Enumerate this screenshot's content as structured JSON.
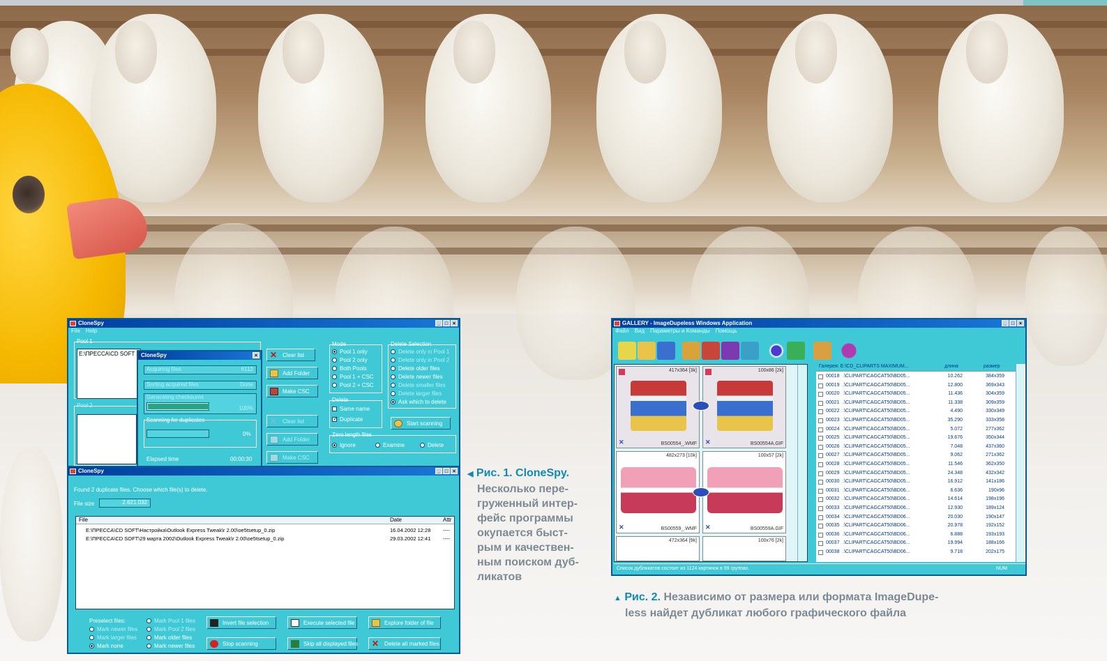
{
  "clonespy": {
    "title": "CloneSpy",
    "menu": [
      "File",
      "Help"
    ],
    "pool1_label": "Pool 1",
    "pool1_item": "E:\\ПРЕССА\\CD SOFT",
    "pool2_label": "Pool 2",
    "buttons": {
      "clear_list": "Clear list",
      "add_folder": "Add Folder",
      "make_csc": "Make CSC",
      "clear_list2": "Clear list",
      "add_folder2": "Add Folder",
      "make_csc2": "Make CSC",
      "start_scanning": "Start scanning"
    },
    "mode": {
      "label": "Mode",
      "options": [
        "Pool 1 only",
        "Pool 2 only",
        "Both Pools",
        "Pool 1 + CSC",
        "Pool 2 + CSC"
      ],
      "selected": "Pool 1 only"
    },
    "delete": {
      "label": "Delete",
      "same_name": "Same name",
      "duplicate": "Duplicate"
    },
    "zero_length": {
      "label": "Zero length files",
      "options": [
        "Ignore",
        "Examine",
        "Delete"
      ],
      "selected": "Ignore"
    },
    "delete_selection": {
      "label": "Delete Selection",
      "options": [
        "Delete only in Pool 1",
        "Delete only in Pool 2",
        "Delete older files",
        "Delete newer files",
        "Delete smaller files",
        "Delete larger files",
        "Ask which to delete"
      ],
      "selected": "Ask which to delete"
    },
    "progress_dialog": {
      "title": "CloneSpy",
      "rows": [
        {
          "label": "Acquiring files",
          "value": "6112"
        },
        {
          "label": "Sorting acquired files",
          "value": "Done"
        },
        {
          "label": "Generating checksums",
          "value": "100%"
        }
      ],
      "checksum_progress": 1.0,
      "scanning_label": "Scanning for duplicates",
      "scanning_value": "0%",
      "scanning_progress": 0.0,
      "elapsed_label": "Elapsed time",
      "elapsed_value": "00:00:30"
    }
  },
  "clonespy2": {
    "title": "CloneSpy",
    "message": "Found 2 duplicate files. Choose which file(s) to delete.",
    "file_size_label": "File size",
    "file_size_value": "2.621.032",
    "columns": [
      "File",
      "Date",
      "Attr"
    ],
    "files": [
      {
        "path": "E:\\ПРЕССА\\CD SOFT\\Настройка\\Outlook Express Tweak\\r 2.00\\oe5tsetup_0.zip",
        "date": "16.04.2002 12:28",
        "attr": "----"
      },
      {
        "path": "E:\\ПРЕССА\\CD SOFT\\29 марта 2002\\Outlook Express Tweak\\r 2.00\\oe5tsetup_0.zip",
        "date": "29.03.2002 12:41",
        "attr": "----"
      }
    ],
    "preselect_label": "Preselect files:",
    "preselect": [
      "Mark newer files",
      "Mark larger files",
      "Mark none",
      "Mark Pool 1 files",
      "Mark Pool 2 files",
      "Mark older files",
      "Mark newer files"
    ],
    "actions": {
      "invert": "Invert file selection",
      "execute": "Execute selected file",
      "explore": "Explore folder of file",
      "stop": "Stop scanning",
      "skip": "Skip all displayed files",
      "delete_marked": "Delete all marked files"
    }
  },
  "caption1": {
    "head": "Рис. 1. CloneSpy.",
    "lines": [
      "Несколько пере-",
      "груженный интер-",
      "фейс программы",
      "окупается быст-",
      "рым и качествен-",
      "ным поиском дуб-",
      "ликатов"
    ]
  },
  "caption2": {
    "head": "Рис. 2.",
    "lines": [
      "Независимо от размера или формата ImageDupe-",
      "less найдет дубликат любого графического файла"
    ]
  },
  "gallery": {
    "title": "GALLERY - ImageDupeless Windows Application",
    "menu": [
      "Файл",
      "Вид",
      "Параметры и Команды",
      "Помощь"
    ],
    "thumbs": [
      {
        "size": "417x364 [3k]",
        "name": "BS00554_.WMF"
      },
      {
        "size": "100x86 [2k]",
        "name": "BS00554A.GIF"
      },
      {
        "size": "482x273 [10k]",
        "name": "BS00559_.WMF"
      },
      {
        "size": "100x57 [2k]",
        "name": "BS00559A.GIF"
      },
      {
        "size": "472x364 [9k]",
        "name": ""
      },
      {
        "size": "100x76 [2k]",
        "name": ""
      }
    ],
    "table_header": [
      "Галерея: E:\\CD_CLIPARTS MAXIMUM...",
      "длина",
      "размер"
    ],
    "rows": [
      [
        "00018",
        ".\\CLIPART\\CAGCAT50\\BD05...",
        "10.262",
        "384x359"
      ],
      [
        "00019",
        ".\\CLIPART\\CAGCAT50\\BD05...",
        "12.800",
        "369x343"
      ],
      [
        "00020",
        ".\\CLIPART\\CAGCAT50\\BD05...",
        "11.436",
        "304x359"
      ],
      [
        "00021",
        ".\\CLIPART\\CAGCAT50\\BD05...",
        "11.338",
        "309x359"
      ],
      [
        "00022",
        ".\\CLIPART\\CAGCAT50\\BD05...",
        "4.490",
        "330x349"
      ],
      [
        "00023",
        ".\\CLIPART\\CAGCAT50\\BD05...",
        "35.290",
        "333x358"
      ],
      [
        "00024",
        ".\\CLIPART\\CAGCAT50\\BD05...",
        "5.072",
        "277x362"
      ],
      [
        "00025",
        ".\\CLIPART\\CAGCAT50\\BD05...",
        "19.676",
        "350x344"
      ],
      [
        "00026",
        ".\\CLIPART\\CAGCAT50\\BD05...",
        "7.048",
        "437x360"
      ],
      [
        "00027",
        ".\\CLIPART\\CAGCAT50\\BD05...",
        "9.062",
        "271x362"
      ],
      [
        "00028",
        ".\\CLIPART\\CAGCAT50\\BD05...",
        "11.546",
        "362x350"
      ],
      [
        "00029",
        ".\\CLIPART\\CAGCAT50\\BD05...",
        "24.348",
        "432x342"
      ],
      [
        "00030",
        ".\\CLIPART\\CAGCAT50\\BD05...",
        "16.912",
        "141x186"
      ],
      [
        "00031",
        ".\\CLIPART\\CAGCAT50\\BD06...",
        "6.636",
        "190x96"
      ],
      [
        "00032",
        ".\\CLIPART\\CAGCAT50\\BD06...",
        "14.614",
        "198x196"
      ],
      [
        "00033",
        ".\\CLIPART\\CAGCAT50\\BD06...",
        "12.930",
        "189x124"
      ],
      [
        "00034",
        ".\\CLIPART\\CAGCAT50\\BD06...",
        "20.030",
        "190x147"
      ],
      [
        "00035",
        ".\\CLIPART\\CAGCAT50\\BD06...",
        "20.978",
        "192x152"
      ],
      [
        "00036",
        ".\\CLIPART\\CAGCAT50\\BD06...",
        "6.888",
        "193x193"
      ],
      [
        "00037",
        ".\\CLIPART\\CAGCAT50\\BD06...",
        "19.994",
        "188x166"
      ],
      [
        "00038",
        ".\\CLIPART\\CAGCAT50\\BD06...",
        "9.718",
        "202x175"
      ]
    ],
    "status": "Список дубликатов состоит из 1124 картинок в 99 группах.",
    "status_right": "NUM"
  }
}
